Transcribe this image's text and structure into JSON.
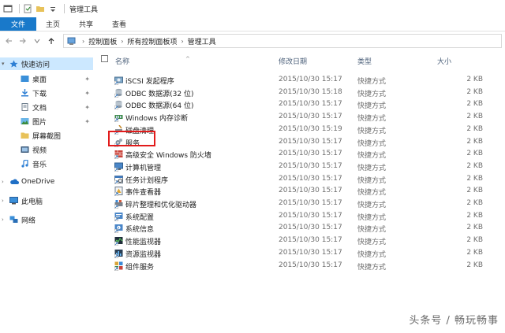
{
  "window": {
    "title": "管理工具"
  },
  "ribbon": {
    "tabs": [
      "文件",
      "主页",
      "共享",
      "查看"
    ]
  },
  "address": {
    "crumbs": [
      "控制面板",
      "所有控制面板项",
      "管理工具"
    ]
  },
  "sidebar": {
    "quick_access": "快速访问",
    "items": [
      {
        "label": "桌面",
        "icon": "desktop-icon",
        "pinned": true
      },
      {
        "label": "下载",
        "icon": "download-icon",
        "pinned": true
      },
      {
        "label": "文档",
        "icon": "document-icon",
        "pinned": true
      },
      {
        "label": "图片",
        "icon": "picture-icon",
        "pinned": true
      },
      {
        "label": "屏幕截图",
        "icon": "folder-icon",
        "pinned": false
      },
      {
        "label": "视频",
        "icon": "video-icon",
        "pinned": false
      },
      {
        "label": "音乐",
        "icon": "music-icon",
        "pinned": false
      }
    ],
    "onedrive": "OneDrive",
    "this_pc": "此电脑",
    "network": "网络"
  },
  "columns": {
    "name": "名称",
    "date": "修改日期",
    "type": "类型",
    "size": "大小"
  },
  "files": [
    {
      "name": "iSCSI 发起程序",
      "date": "2015/10/30 15:17",
      "type": "快捷方式",
      "size": "2 KB",
      "icon": "iscsi-icon"
    },
    {
      "name": "ODBC 数据源(32 位)",
      "date": "2015/10/30 15:18",
      "type": "快捷方式",
      "size": "2 KB",
      "icon": "odbc-icon"
    },
    {
      "name": "ODBC 数据源(64 位)",
      "date": "2015/10/30 15:17",
      "type": "快捷方式",
      "size": "2 KB",
      "icon": "odbc-icon"
    },
    {
      "name": "Windows 内存诊断",
      "date": "2015/10/30 15:17",
      "type": "快捷方式",
      "size": "2 KB",
      "icon": "memory-icon"
    },
    {
      "name": "磁盘清理",
      "date": "2015/10/30 15:19",
      "type": "快捷方式",
      "size": "2 KB",
      "icon": "disk-cleanup-icon"
    },
    {
      "name": "服务",
      "date": "2015/10/30 15:17",
      "type": "快捷方式",
      "size": "2 KB",
      "icon": "services-icon"
    },
    {
      "name": "高级安全 Windows 防火墙",
      "date": "2015/10/30 15:17",
      "type": "快捷方式",
      "size": "2 KB",
      "icon": "firewall-icon"
    },
    {
      "name": "计算机管理",
      "date": "2015/10/30 15:17",
      "type": "快捷方式",
      "size": "2 KB",
      "icon": "computer-management-icon"
    },
    {
      "name": "任务计划程序",
      "date": "2015/10/30 15:17",
      "type": "快捷方式",
      "size": "2 KB",
      "icon": "task-scheduler-icon"
    },
    {
      "name": "事件查看器",
      "date": "2015/10/30 15:17",
      "type": "快捷方式",
      "size": "2 KB",
      "icon": "event-viewer-icon"
    },
    {
      "name": "碎片整理和优化驱动器",
      "date": "2015/10/30 15:17",
      "type": "快捷方式",
      "size": "2 KB",
      "icon": "defrag-icon"
    },
    {
      "name": "系统配置",
      "date": "2015/10/30 15:17",
      "type": "快捷方式",
      "size": "2 KB",
      "icon": "system-config-icon"
    },
    {
      "name": "系统信息",
      "date": "2015/10/30 15:17",
      "type": "快捷方式",
      "size": "2 KB",
      "icon": "system-info-icon"
    },
    {
      "name": "性能监视器",
      "date": "2015/10/30 15:17",
      "type": "快捷方式",
      "size": "2 KB",
      "icon": "performance-icon"
    },
    {
      "name": "资源监视器",
      "date": "2015/10/30 15:17",
      "type": "快捷方式",
      "size": "2 KB",
      "icon": "resource-monitor-icon"
    },
    {
      "name": "组件服务",
      "date": "2015/10/30 15:17",
      "type": "快捷方式",
      "size": "2 KB",
      "icon": "component-services-icon"
    }
  ],
  "highlight_color": "#e21b1b",
  "accent_color": "#1979ca",
  "watermark": "头条号 / 畅玩畅事"
}
